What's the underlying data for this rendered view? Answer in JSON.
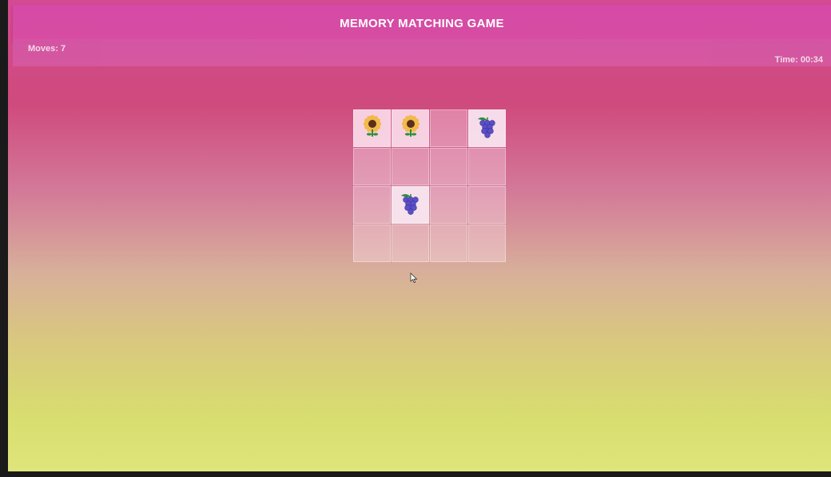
{
  "game": {
    "title": "MEMORY MATCHING GAME",
    "moves_label": "Moves: 7",
    "time_label": "Time: 00:34"
  },
  "board": {
    "rows": 4,
    "cols": 4,
    "cards": [
      {
        "state": "revealed",
        "icon": "sunflower-icon"
      },
      {
        "state": "revealed",
        "icon": "sunflower-icon"
      },
      {
        "state": "hidden",
        "icon": ""
      },
      {
        "state": "revealed",
        "icon": "grapes-icon"
      },
      {
        "state": "hidden",
        "icon": ""
      },
      {
        "state": "hidden",
        "icon": ""
      },
      {
        "state": "hidden",
        "icon": ""
      },
      {
        "state": "hidden",
        "icon": ""
      },
      {
        "state": "hidden",
        "icon": ""
      },
      {
        "state": "revealed",
        "icon": "grapes-icon"
      },
      {
        "state": "hidden",
        "icon": ""
      },
      {
        "state": "hidden",
        "icon": ""
      },
      {
        "state": "hidden",
        "icon": ""
      },
      {
        "state": "hidden",
        "icon": ""
      },
      {
        "state": "hidden",
        "icon": ""
      },
      {
        "state": "hidden",
        "icon": ""
      }
    ]
  },
  "colors": {
    "header": "#d44aa6",
    "petal": "#f3b94b",
    "center": "#5a2f1b",
    "stem": "#2f8f3a",
    "grape": "#5a4fc8",
    "leaf": "#2e8b3f"
  }
}
